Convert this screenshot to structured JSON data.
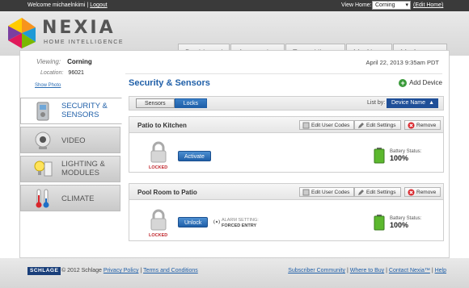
{
  "topbar": {
    "welcome": "Welcome michaelnkimi",
    "separator": "|",
    "logout": "Logout",
    "view_home_label": "View Home:",
    "view_home_value": "Corning",
    "edit_home": "(Edit Home)"
  },
  "brand": {
    "name": "NEXIA",
    "tagline": "HOME INTELLIGENCE"
  },
  "tabs": [
    "Dashboard",
    "Automation",
    "Event History",
    "My Alerts",
    "My Account"
  ],
  "info": {
    "viewing_label": "Viewing:",
    "viewing_value": "Corning",
    "location_label": "Location:",
    "location_value": "96021",
    "show_photo": "Show Photo",
    "datetime": "April 22, 2013   9:35am PDT"
  },
  "sidenav": [
    {
      "label": "Security & Sensors",
      "icon": "lock-device-icon"
    },
    {
      "label": "Video",
      "icon": "camera-icon"
    },
    {
      "label": "Lighting & Modules",
      "icon": "lightbulb-icon"
    },
    {
      "label": "Climate",
      "icon": "thermometer-icon"
    }
  ],
  "content": {
    "title": "Security & Sensors",
    "add_device": "Add Device",
    "segment": [
      "Sensors",
      "Locks"
    ],
    "list_by_label": "List by:",
    "list_by_value": "Device Name"
  },
  "devices": [
    {
      "name": "Patio to Kitchen",
      "edit_codes": "Edit User Codes",
      "edit_settings": "Edit Settings",
      "remove": "Remove",
      "status": "LOCKED",
      "action": "Activate",
      "battery_label": "Battery Status:",
      "battery_value": "100%"
    },
    {
      "name": "Pool Room to Patio",
      "edit_codes": "Edit User Codes",
      "edit_settings": "Edit Settings",
      "remove": "Remove",
      "status": "LOCKED",
      "action": "Unlock",
      "alarm_label": "ALARM SETTING:",
      "alarm_value": "FORCED ENTRY",
      "battery_label": "Battery Status:",
      "battery_value": "100%"
    }
  ],
  "footer": {
    "badge": "SCHLAGE",
    "copyright": "© 2012 Schlage",
    "privacy": "Privacy Policy",
    "terms": "Terms and Conditions",
    "sep": "|",
    "community": "Subscriber Community",
    "where_to_buy": "Where to Buy",
    "contact": "Contact Nexia™",
    "help": "Help"
  },
  "colors": {
    "accent": "#1f5fa8",
    "locked": "#c0262c",
    "battery": "#3a9a3a"
  }
}
